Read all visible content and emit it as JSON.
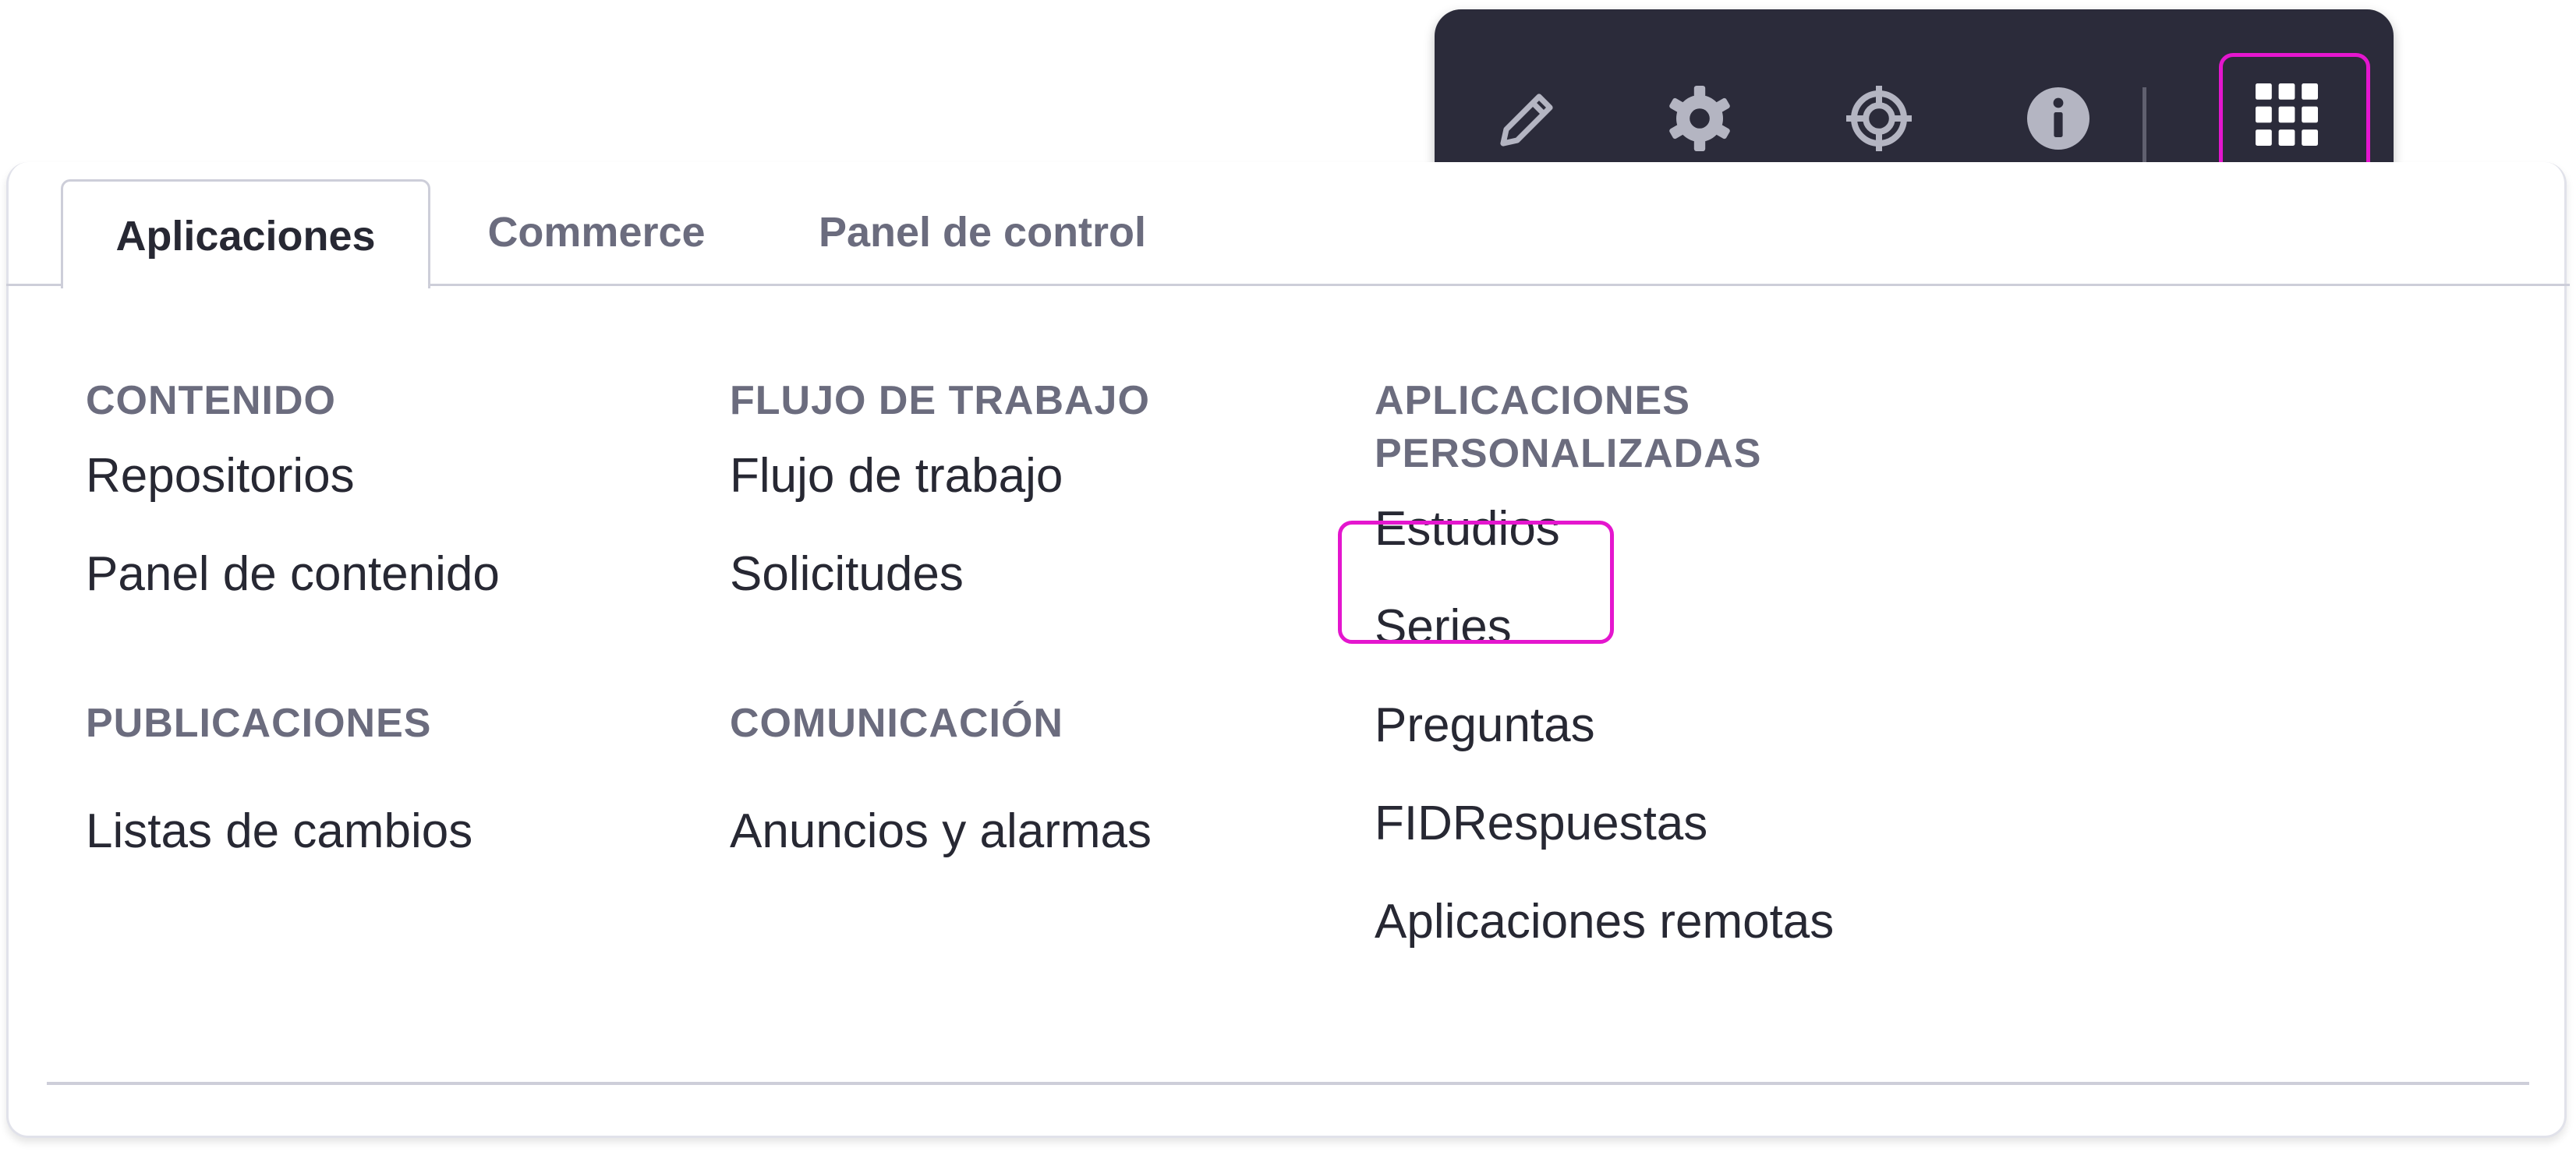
{
  "tabs": [
    {
      "label": "Aplicaciones",
      "active": true
    },
    {
      "label": "Commerce",
      "active": false
    },
    {
      "label": "Panel de control",
      "active": false
    }
  ],
  "groups": {
    "contenido": {
      "title": "CONTENIDO",
      "items": [
        "Repositorios",
        "Panel de contenido"
      ]
    },
    "publicaciones": {
      "title": "PUBLICACIONES",
      "items": [
        "Listas de cambios"
      ]
    },
    "flujo": {
      "title": "FLUJO DE TRABAJO",
      "items": [
        "Flujo de trabajo",
        "Solicitudes"
      ]
    },
    "comunicacion": {
      "title": "COMUNICACIÓN",
      "items": [
        "Anuncios y alarmas"
      ]
    },
    "personalizadas": {
      "title_line1": "APLICACIONES",
      "title_line2": "PERSONALIZADAS",
      "items": [
        "Estudios",
        "Series",
        "Preguntas",
        "FIDRespuestas",
        "Aplicaciones remotas"
      ]
    }
  },
  "toolbar": {
    "icons": [
      "pencil-icon",
      "gear-icon",
      "target-icon",
      "info-icon",
      "apps-grid-icon"
    ]
  },
  "colors": {
    "highlight": "#e416ce",
    "toolbar_bg": "#2b2b3a",
    "group_title": "#6b6c7e",
    "text": "#272833"
  }
}
